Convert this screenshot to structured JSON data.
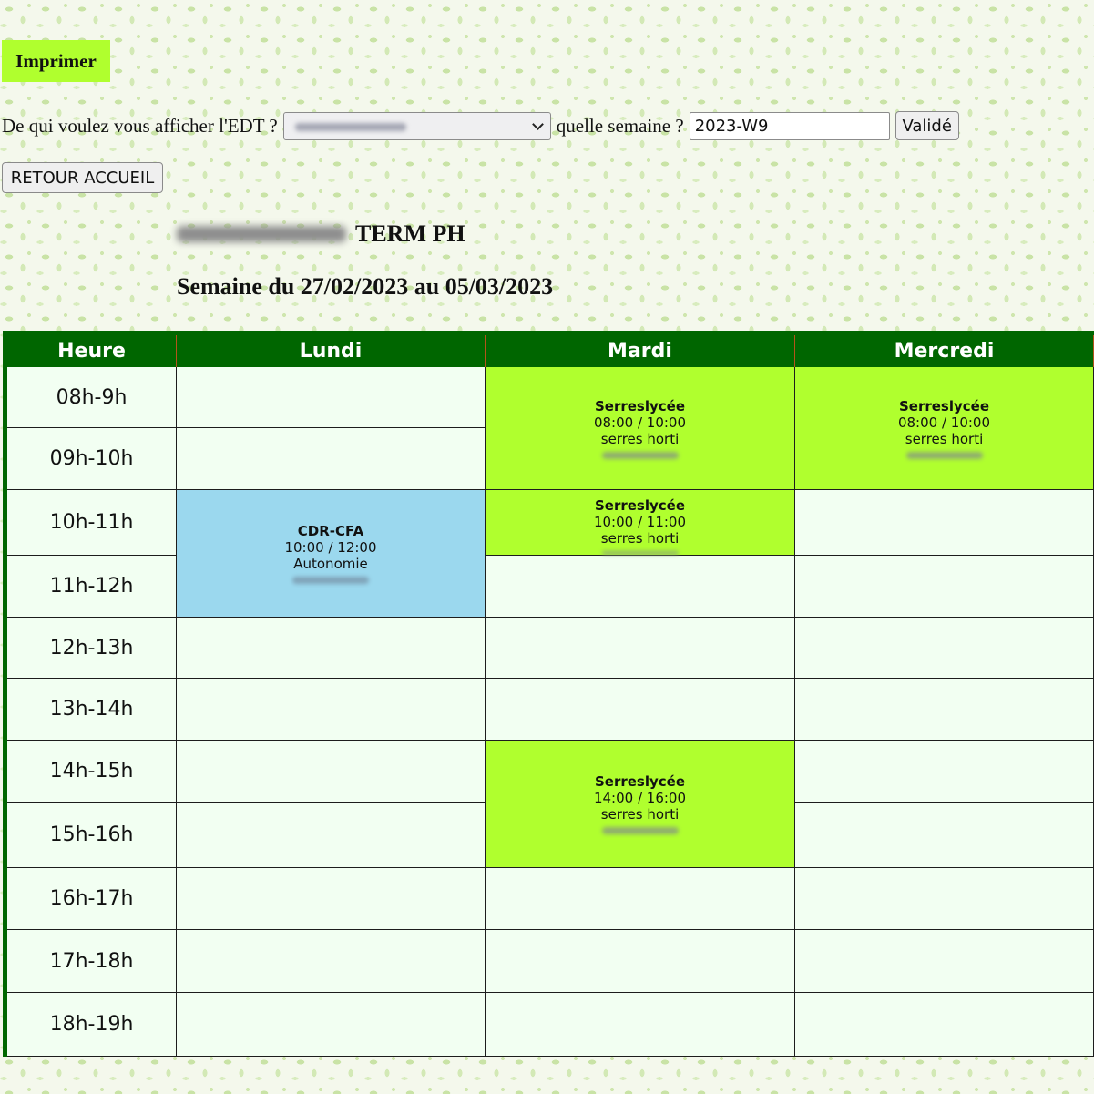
{
  "toolbar": {
    "print_label": "Imprimer",
    "question_label": "De qui voulez vous afficher l'EDT ?",
    "week_label": "quelle semaine ?",
    "week_value": "2023-W9",
    "validate_label": "Validé",
    "back_label": "RETOUR ACCUEIL"
  },
  "header": {
    "class_label": "TERM PH",
    "week_title": "Semaine du 27/02/2023 au 05/03/2023"
  },
  "timetable": {
    "hour_header": "Heure",
    "days": [
      "Lundi",
      "Mardi",
      "Mercredi"
    ],
    "hours": [
      "08h-9h",
      "09h-10h",
      "10h-11h",
      "11h-12h",
      "12h-13h",
      "13h-14h",
      "14h-15h",
      "15h-16h",
      "16h-17h",
      "17h-18h",
      "18h-19h"
    ],
    "events": [
      {
        "day": 0,
        "start": 2,
        "span": 2,
        "color": "blue",
        "name": "CDR-CFA",
        "time": "10:00 / 12:00",
        "room": "Autonomie"
      },
      {
        "day": 1,
        "start": 0,
        "span": 2,
        "color": "green",
        "name": "Serreslycée",
        "time": "08:00 / 10:00",
        "room": "serres horti"
      },
      {
        "day": 1,
        "start": 2,
        "span": 1,
        "color": "green",
        "align": "top",
        "name": "Serreslycée",
        "time": "10:00 / 11:00",
        "room": "serres horti"
      },
      {
        "day": 1,
        "start": 6,
        "span": 2,
        "color": "green",
        "name": "Serreslycée",
        "time": "14:00 / 16:00",
        "room": "serres horti"
      },
      {
        "day": 2,
        "start": 0,
        "span": 2,
        "color": "green",
        "name": "Serreslycée",
        "time": "08:00 / 10:00",
        "room": "serres horti"
      }
    ]
  },
  "colors": {
    "header_green": "#006600",
    "event_green": "#b0ff2e",
    "event_blue": "#9bd8ee",
    "cell_background": "#f2fff2",
    "print_button": "#b0ff2e"
  }
}
